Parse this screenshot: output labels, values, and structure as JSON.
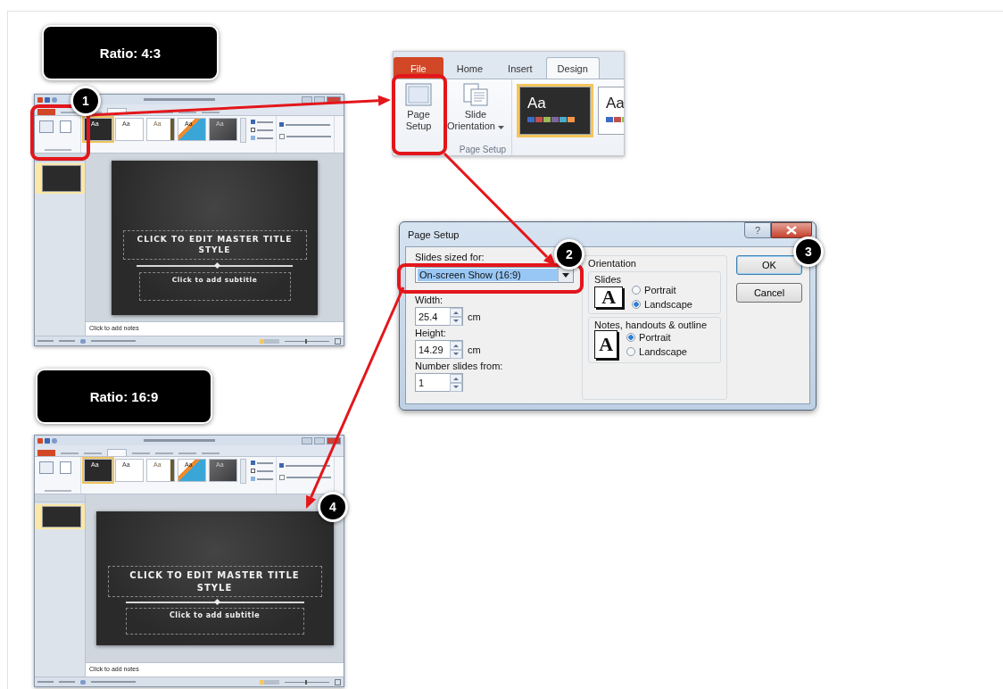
{
  "labels": [
    {
      "text": "Ratio: 4:3"
    },
    {
      "text": "Ratio: 16:9"
    }
  ],
  "callouts": [
    {
      "number": "1"
    },
    {
      "number": "2"
    },
    {
      "number": "3"
    },
    {
      "number": "4"
    }
  ],
  "windows": [
    {
      "themes": [
        {
          "label": "Aa",
          "selected": true
        },
        {
          "label": "Aa",
          "selected": false
        },
        {
          "label": "Aa",
          "selected": false
        },
        {
          "label": "Aa",
          "selected": false
        },
        {
          "label": "Aa",
          "selected": false
        }
      ],
      "thumbnail": {
        "selected": true
      },
      "slide": {
        "title": "CLICK TO EDIT MASTER TITLE STYLE",
        "subtitle": "Click to add subtitle"
      },
      "notes": "Click to add notes"
    },
    {
      "themes": [
        {
          "label": "Aa",
          "selected": true
        },
        {
          "label": "Aa",
          "selected": false
        },
        {
          "label": "Aa",
          "selected": false
        },
        {
          "label": "Aa",
          "selected": false
        },
        {
          "label": "Aa",
          "selected": false
        }
      ],
      "thumbnail": {
        "selected": true
      },
      "slide": {
        "title": "CLICK TO EDIT MASTER TITLE STYLE",
        "subtitle": "Click to add subtitle"
      },
      "notes": "Click to add notes"
    }
  ],
  "ribbon_zoom": {
    "tabs": [
      {
        "label": "File",
        "selected": false
      },
      {
        "label": "Home",
        "selected": false
      },
      {
        "label": "Insert",
        "selected": false
      },
      {
        "label": "Design",
        "selected": true
      }
    ],
    "buttons": [
      "Page Setup",
      "Slide Orientation"
    ],
    "group_label": "Page Setup",
    "themes": [
      {
        "label": "Aa",
        "selected": true
      },
      {
        "label": "Aa",
        "selected": false
      }
    ]
  },
  "dialog": {
    "title": "Page Setup",
    "help": "?",
    "sized_for": {
      "label": "Slides sized for:",
      "value": "On-screen Show (16:9)"
    },
    "fields": [
      {
        "label": "Width:",
        "value": "25.4",
        "unit": "cm"
      },
      {
        "label": "Height:",
        "value": "14.29",
        "unit": "cm"
      },
      {
        "label": "Number slides from:",
        "value": "1"
      }
    ],
    "orientation": {
      "title": "Orientation",
      "groups": [
        {
          "title": "Slides",
          "icon_letter": "A",
          "options": [
            {
              "label": "Portrait",
              "selected": false
            },
            {
              "label": "Landscape",
              "selected": true
            }
          ]
        },
        {
          "title": "Notes, handouts & outline",
          "icon_letter": "A",
          "options": [
            {
              "label": "Portrait",
              "selected": true
            },
            {
              "label": "Landscape",
              "selected": false
            }
          ]
        }
      ]
    },
    "buttons": [
      "OK",
      "Cancel"
    ]
  }
}
